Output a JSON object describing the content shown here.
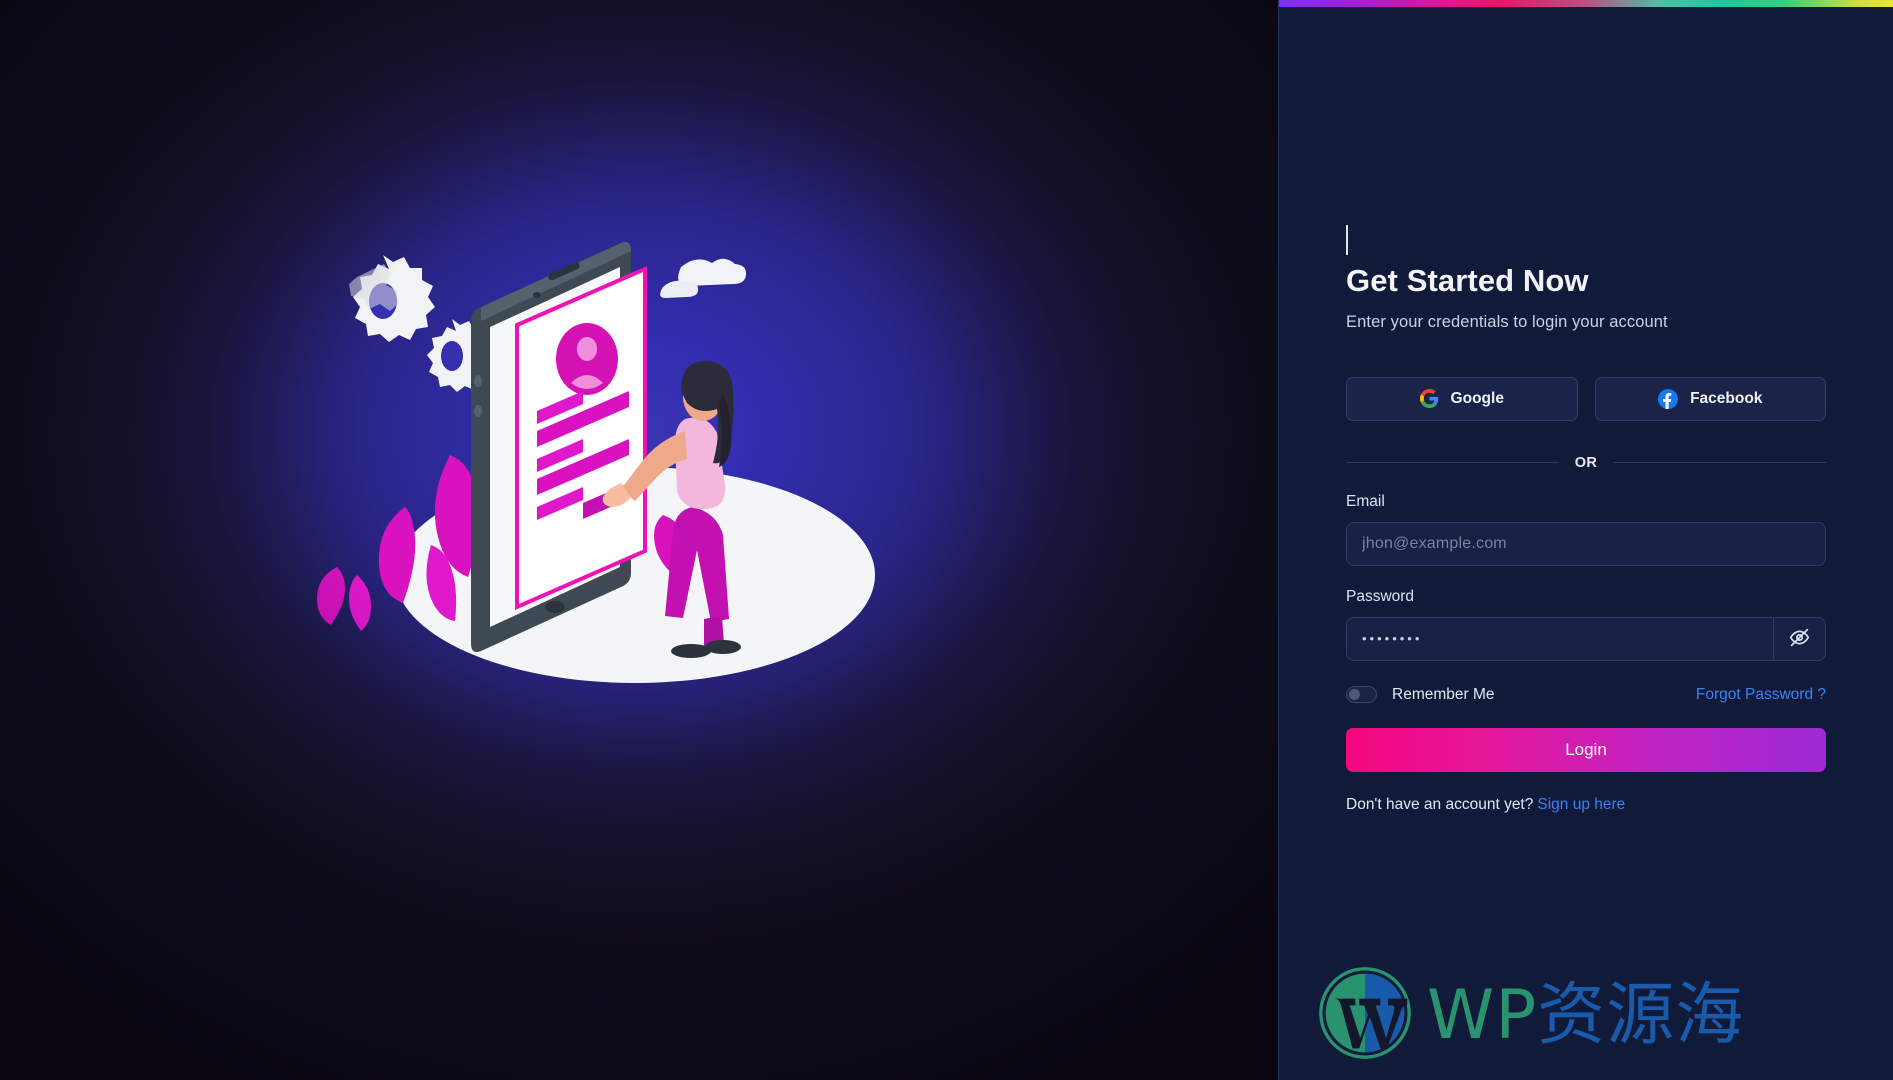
{
  "theme": {
    "left_bg_dark": "#110d1c",
    "left_glow": "#3c34b4",
    "right_panel_bg": "#121a39",
    "accent_pink": "#f5067f",
    "accent_purple": "#9c2bd6",
    "link_blue": "#3b82f6",
    "input_bg": "#172045",
    "input_border": "#333d5f",
    "topbar_gradient": "purple-pink-teal-yellow"
  },
  "header": {
    "title": "Get Started Now",
    "subtitle": "Enter your credentials to login your account"
  },
  "social": {
    "google_label": "Google",
    "facebook_label": "Facebook",
    "google_icon": "google-icon",
    "facebook_icon": "facebook-icon"
  },
  "divider": {
    "text": "OR"
  },
  "form": {
    "email": {
      "label": "Email",
      "placeholder": "jhon@example.com",
      "value": ""
    },
    "password": {
      "label": "Password",
      "value": "••••••••",
      "placeholder": "",
      "toggle_icon": "eye-off-icon",
      "masked": true
    }
  },
  "options": {
    "remember_label": "Remember Me",
    "remember_checked": false,
    "forgot_label": "Forgot Password ?"
  },
  "actions": {
    "login_label": "Login"
  },
  "signup": {
    "prompt": "Don't have an account yet?",
    "link_label": "Sign up here"
  },
  "watermark": {
    "logo_icon": "wordpress-logo-icon",
    "text_latin": "WP",
    "text_cjk": "资源海"
  },
  "illustration": {
    "name": "mobile-login-illustration",
    "description": "Isometric smartphone showing a login profile card with a woman tapping the screen, floating gears, a cloud and magenta plants on a white ellipse"
  }
}
